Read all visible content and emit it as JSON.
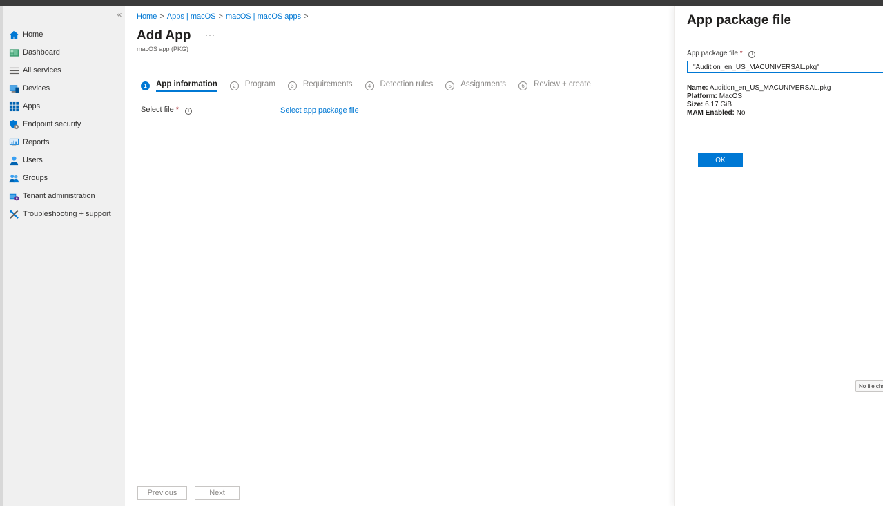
{
  "sidebar": {
    "collapse_label": "«",
    "items": [
      {
        "label": "Home",
        "icon": "home-icon"
      },
      {
        "label": "Dashboard",
        "icon": "dashboard-icon"
      },
      {
        "label": "All services",
        "icon": "all-services-icon"
      },
      {
        "label": "Devices",
        "icon": "devices-icon"
      },
      {
        "label": "Apps",
        "icon": "apps-icon"
      },
      {
        "label": "Endpoint security",
        "icon": "endpoint-security-icon"
      },
      {
        "label": "Reports",
        "icon": "reports-icon"
      },
      {
        "label": "Users",
        "icon": "users-icon"
      },
      {
        "label": "Groups",
        "icon": "groups-icon"
      },
      {
        "label": "Tenant administration",
        "icon": "tenant-admin-icon"
      },
      {
        "label": "Troubleshooting + support",
        "icon": "troubleshooting-icon"
      }
    ]
  },
  "breadcrumb": {
    "items": [
      "Home",
      "Apps | macOS",
      "macOS | macOS apps"
    ],
    "separator": ">"
  },
  "page": {
    "title": "Add App",
    "more": "···",
    "subtitle": "macOS app (PKG)"
  },
  "steps": [
    {
      "num": "1",
      "label": "App information"
    },
    {
      "num": "2",
      "label": "Program"
    },
    {
      "num": "3",
      "label": "Requirements"
    },
    {
      "num": "4",
      "label": "Detection rules"
    },
    {
      "num": "5",
      "label": "Assignments"
    },
    {
      "num": "6",
      "label": "Review + create"
    }
  ],
  "form": {
    "select_file_label": "Select file",
    "required_mark": "*",
    "info": "i",
    "select_file_link": "Select app package file"
  },
  "footer": {
    "previous": "Previous",
    "next": "Next"
  },
  "panel": {
    "title": "App package file",
    "field_label": "App package file",
    "required_mark": "*",
    "info": "i",
    "field_value": "\"Audition_en_US_MACUNIVERSAL.pkg\"",
    "props": [
      {
        "key": "Name:",
        "value": "Audition_en_US_MACUNIVERSAL.pkg"
      },
      {
        "key": "Platform:",
        "value": "MacOS"
      },
      {
        "key": "Size:",
        "value": "6.17 GiB"
      },
      {
        "key": "MAM Enabled:",
        "value": "No"
      }
    ],
    "ok": "OK",
    "no_file": "No file chosen"
  },
  "colors": {
    "accent": "#0078d4",
    "required": "#a4262c",
    "sidebar_bg": "#f0f0f0"
  }
}
